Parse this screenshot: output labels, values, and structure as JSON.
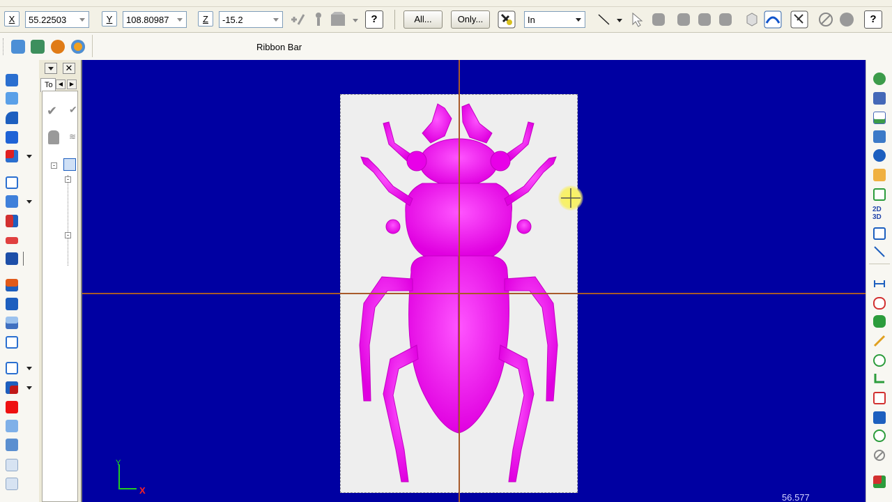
{
  "coordinates": {
    "x_label": "X",
    "x_value": "55.22503",
    "y_label": "Y",
    "y_value": "108.80987",
    "z_label": "Z",
    "z_value": "-15.2"
  },
  "toolbar": {
    "all_label": "All...",
    "only_label": "Only...",
    "units_value": "In",
    "help_label": "?"
  },
  "ribbon": {
    "label": "Ribbon Bar"
  },
  "tree_panel": {
    "tab_label": "To"
  },
  "viewport": {
    "axis_y_label": "Y",
    "axis_x_label": "X",
    "status_value": "56.577",
    "model_color": "#ee00ee",
    "background_color": "#0000a2"
  },
  "right_toolbar": {
    "mode_2d": "2D",
    "mode_3d": "3D"
  }
}
